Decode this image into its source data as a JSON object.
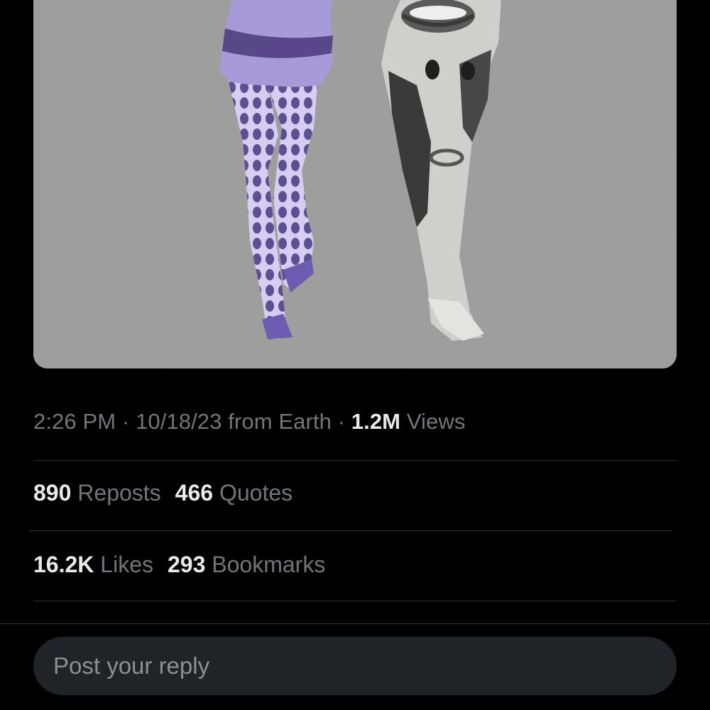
{
  "post": {
    "media": {
      "kind": "photo",
      "description_icon": "collage-image"
    },
    "meta": {
      "time": "2:26 PM",
      "separator": " · ",
      "date": "10/18/23",
      "source": " from Earth",
      "views_count": "1.2M",
      "views_label": " Views"
    },
    "stats": {
      "reposts_count": "890",
      "reposts_label": " Reposts",
      "quotes_count": "466",
      "quotes_label": " Quotes",
      "likes_count": "16.2K",
      "likes_label": " Likes",
      "bookmarks_count": "293",
      "bookmarks_label": " Bookmarks"
    }
  },
  "reply": {
    "placeholder": "Post your reply"
  },
  "colors": {
    "background": "#000000",
    "text_primary": "#e7e9ea",
    "text_secondary": "#71767b",
    "divider": "#2f3336",
    "input_bg": "#202327",
    "media_bg": "#9b9b99",
    "accent_purple": "#8f7fc4"
  }
}
